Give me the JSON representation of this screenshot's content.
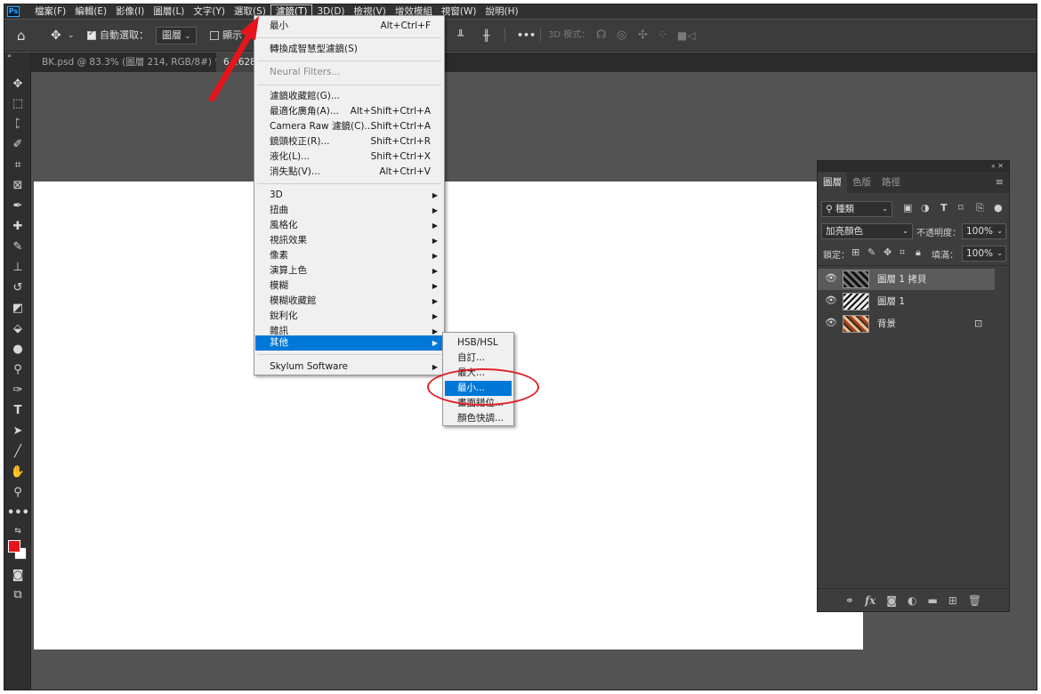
{
  "menubar": {
    "logo": "Ps",
    "items": [
      "檔案(F)",
      "編輯(E)",
      "影像(I)",
      "圖層(L)",
      "文字(Y)",
      "選取(S)",
      "濾鏡(T)",
      "3D(D)",
      "檢視(V)",
      "增效模組",
      "視窗(W)",
      "說明(H)"
    ],
    "active": "濾鏡(T)"
  },
  "options_bar": {
    "auto_select_label": "自動選取：",
    "auto_select_checked": true,
    "auto_select_target": "圖層",
    "show_label": "顯示",
    "mode_3d_label": "3D 模式："
  },
  "tabs": [
    {
      "label": "BK.psd @ 83.3% (圖層 214, RGB/8#) *",
      "close": "×"
    },
    {
      "label": "6...6284"
    }
  ],
  "filter_menu": {
    "items": [
      {
        "label": "最小",
        "shortcut": "Alt+Ctrl+F"
      },
      {
        "label": "轉換成智慧型濾鏡(S)"
      },
      {
        "label": "Neural Filters...",
        "disabled": true
      },
      {
        "label": "濾鏡收藏館(G)..."
      },
      {
        "label": "最適化廣角(A)...",
        "shortcut": "Alt+Shift+Ctrl+A"
      },
      {
        "label": "Camera Raw 濾鏡(C)...",
        "shortcut": "Shift+Ctrl+A"
      },
      {
        "label": "鏡頭校正(R)...",
        "shortcut": "Shift+Ctrl+R"
      },
      {
        "label": "液化(L)...",
        "shortcut": "Shift+Ctrl+X"
      },
      {
        "label": "消失點(V)...",
        "shortcut": "Alt+Ctrl+V"
      },
      {
        "label": "3D",
        "submenu": true
      },
      {
        "label": "扭曲",
        "submenu": true
      },
      {
        "label": "風格化",
        "submenu": true
      },
      {
        "label": "視訊效果",
        "submenu": true
      },
      {
        "label": "像素",
        "submenu": true
      },
      {
        "label": "演算上色",
        "submenu": true
      },
      {
        "label": "模糊",
        "submenu": true
      },
      {
        "label": "模糊收藏館",
        "submenu": true
      },
      {
        "label": "銳利化",
        "submenu": true
      },
      {
        "label": "雜訊",
        "submenu": true
      },
      {
        "label": "其他",
        "submenu": true,
        "highlighted": true
      },
      {
        "label": "Skylum Software",
        "submenu": true
      }
    ]
  },
  "other_submenu": {
    "items": [
      {
        "label": "HSB/HSL"
      },
      {
        "label": "自訂..."
      },
      {
        "label": "最大..."
      },
      {
        "label": "最小...",
        "highlighted": true
      },
      {
        "label": "畫面錯位..."
      },
      {
        "label": "顏色快調..."
      }
    ]
  },
  "layers_panel": {
    "tabs": [
      "圖層",
      "色版",
      "路徑"
    ],
    "filter_kind": "種類",
    "blend_mode": "加亮顏色",
    "opacity_label": "不透明度：",
    "opacity_value": "100%",
    "lock_label": "鎖定：",
    "fill_label": "填滿：",
    "fill_value": "100%",
    "layers": [
      {
        "name": "圖層 1 拷貝",
        "selected": true
      },
      {
        "name": "圖層 1",
        "selected": false
      },
      {
        "name": "背景",
        "selected": false,
        "locked": true
      }
    ],
    "footer_icons": [
      "link-icon",
      "fx-icon",
      "mask-icon",
      "adjustment-icon",
      "folder-icon",
      "new-layer-icon",
      "trash-icon"
    ]
  },
  "colors": {
    "foreground": "#e8141b",
    "background": "#ffffff",
    "menu_highlight": "#0078d7",
    "annotation": "#e0242b"
  }
}
